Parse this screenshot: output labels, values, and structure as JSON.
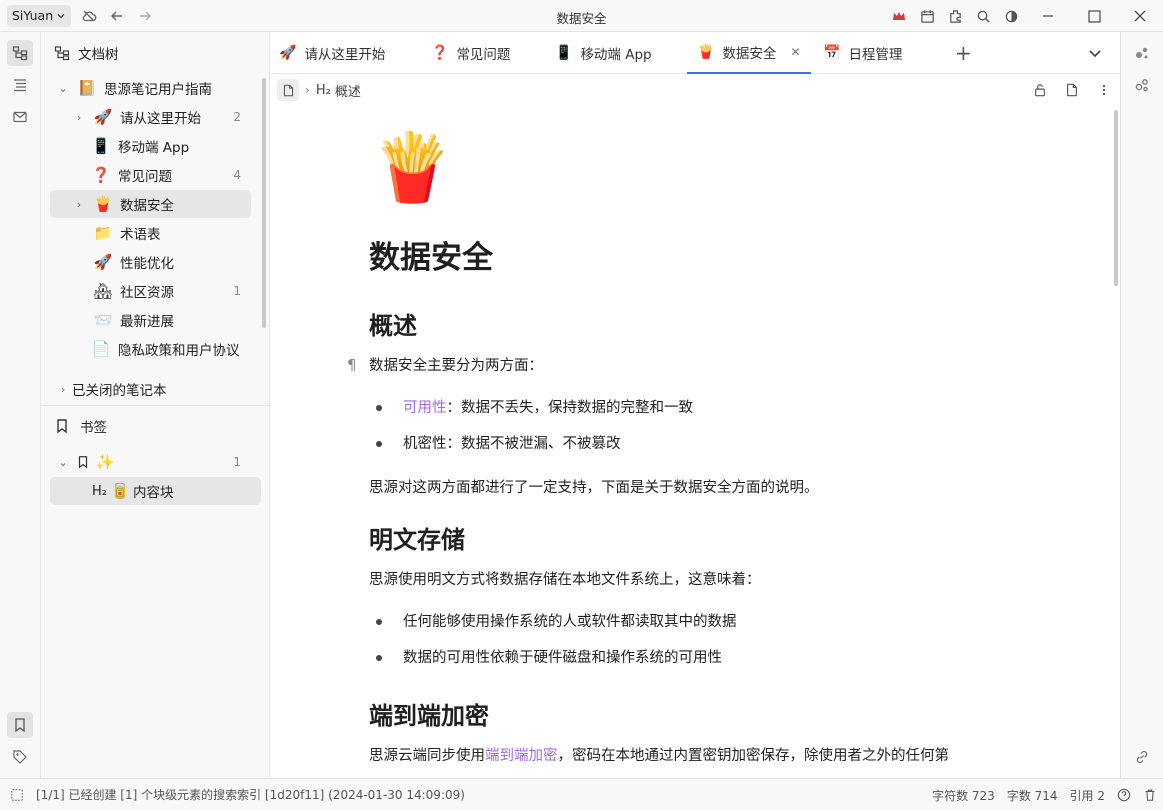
{
  "topbar": {
    "brand": "SiYuan",
    "window_title": "数据安全"
  },
  "filetree": {
    "header": "文档树",
    "notebook": "思源笔记用户指南",
    "items": [
      {
        "emoji": "🚀",
        "label": "请从这里开始",
        "count": "2",
        "has_arrow": true
      },
      {
        "emoji": "📱",
        "label": "移动端 App",
        "count": "",
        "has_arrow": false
      },
      {
        "emoji": "❓",
        "label": "常见问题",
        "count": "4",
        "has_arrow": false
      },
      {
        "emoji": "🍟",
        "label": "数据安全",
        "count": "",
        "has_arrow": true
      },
      {
        "emoji": "📁",
        "label": "术语表",
        "count": "",
        "has_arrow": false
      },
      {
        "emoji": "🚀",
        "label": "性能优化",
        "count": "",
        "has_arrow": false
      },
      {
        "emoji": "🏘",
        "label": "社区资源",
        "count": "1",
        "has_arrow": false
      },
      {
        "emoji": "📨",
        "label": "最新进展",
        "count": "",
        "has_arrow": false
      },
      {
        "emoji": "📄",
        "label": "隐私政策和用户协议",
        "count": "",
        "has_arrow": false
      }
    ],
    "closed_notebooks": "已关闭的笔记本",
    "bookmarks_header": "书签",
    "bookmark_group_count": "1",
    "bookmark_item_label": "内容块"
  },
  "tabs": [
    {
      "emoji": "🚀",
      "label": "请从这里开始"
    },
    {
      "emoji": "❓",
      "label": "常见问题"
    },
    {
      "emoji": "📱",
      "label": "移动端 App"
    },
    {
      "emoji": "🍟",
      "label": "数据安全",
      "active": true
    },
    {
      "emoji": "📅",
      "label": "日程管理"
    }
  ],
  "breadcrumb": {
    "heading_prefix": "H₂",
    "label": "概述"
  },
  "document": {
    "icon": "🍟",
    "title": "数据安全",
    "h2_overview": "概述",
    "p_intro": "数据安全主要分为两方面：",
    "li_availability_link": "可用性",
    "li_availability_rest": "：数据不丢失，保持数据的完整和一致",
    "li_confidentiality": "机密性：数据不被泄漏、不被篡改",
    "p_support": "思源对这两方面都进行了一定支持，下面是关于数据安全方面的说明。",
    "h2_plaintext": "明文存储",
    "p_plaintext": "思源使用明文方式将数据存储在本地文件系统上，这意味着：",
    "li_plaintext_1": "任何能够使用操作系统的人或软件都读取其中的数据",
    "li_plaintext_2": "数据的可用性依赖于硬件磁盘和操作系统的可用性",
    "h2_e2e": "端到端加密",
    "p_e2e_start": "思源云端同步使用",
    "p_e2e_link": "端到端加密",
    "p_e2e_end": "，密码在本地通过内置密钥加密保存，除使用者之外的任何第"
  },
  "statusbar": {
    "message": "[1/1] 已经创建 [1] 个块级元素的搜索索引 [1d20f11] (2024-01-30 14:09:09)",
    "char_count": "字符数 723",
    "word_count": "字数 714",
    "ref_count": "引用 2"
  },
  "colors": {
    "accent": "#3575f0",
    "link": "#a06be0"
  }
}
